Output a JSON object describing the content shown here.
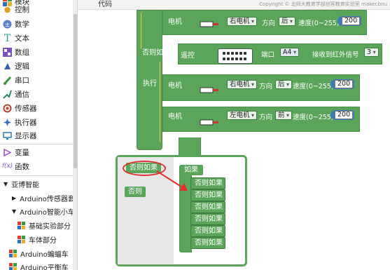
{
  "sidebar": {
    "items": [
      {
        "label": "模块",
        "icon": "module-icon",
        "color": "#1e73be"
      },
      {
        "label": "控制",
        "icon": "control-icon",
        "color": "#e0a020"
      },
      {
        "label": "数学",
        "icon": "math-icon",
        "color": "#5a7fd0"
      },
      {
        "label": "文本",
        "icon": "text-icon",
        "color": "#2a9d8f"
      },
      {
        "label": "数组",
        "icon": "array-icon",
        "color": "#7a4fc0"
      },
      {
        "label": "逻辑",
        "icon": "logic-icon",
        "color": "#3060b0"
      },
      {
        "label": "串口",
        "icon": "serial-icon",
        "color": "#3a9a3a"
      },
      {
        "label": "通信",
        "icon": "communication-icon",
        "color": "#2a8a6a"
      },
      {
        "label": "传感器",
        "icon": "sensor-icon",
        "color": "#c04030"
      },
      {
        "label": "执行器",
        "icon": "actuator-icon",
        "color": "#3070c0"
      },
      {
        "label": "显示器",
        "icon": "display-icon",
        "color": "#2c7fb8"
      },
      {
        "label": "变量",
        "icon": "variable-icon",
        "color": "#9b4fc9"
      },
      {
        "label": "函数",
        "icon": "function-icon",
        "color": "#7b5fc0"
      }
    ],
    "tree": [
      {
        "label": "亚博智能",
        "triangle": "▼"
      },
      {
        "label": "Arduino传感器套件",
        "triangle": "▶"
      },
      {
        "label": "Arduino智能小车",
        "triangle": "▼"
      },
      {
        "label": "基础实验部分"
      },
      {
        "label": "车体部分"
      },
      {
        "label": "Arduino蝙蝠车"
      },
      {
        "label": "Arduino平衡车"
      }
    ]
  },
  "workspace": {
    "tab": "代码",
    "watermark": "Copyright © 北师大教育学部创客教育实验室 maker.bnu",
    "blocks": {
      "motor_label": "电机",
      "else_if": "否则如果",
      "remote": "遥控",
      "port": "端口",
      "port_value": "A4",
      "receive_ir": "接收到红外信号",
      "ir_value": "3",
      "execute": "执行",
      "direction": "方向",
      "speed": "速度(0~255)",
      "rows": [
        {
          "motor": "右电机",
          "dir": "后",
          "speed": "200"
        },
        {
          "motor": "右电机",
          "dir": "后",
          "speed": "200"
        },
        {
          "motor": "左电机",
          "dir": "前",
          "speed": "200"
        }
      ]
    },
    "popup": {
      "left_blocks": [
        "否则如果",
        "否则"
      ],
      "if_label": "如果",
      "stack": [
        "否则如果",
        "否则如果",
        "否则如果",
        "否则如果",
        "否则如果",
        "否则如果"
      ]
    }
  }
}
